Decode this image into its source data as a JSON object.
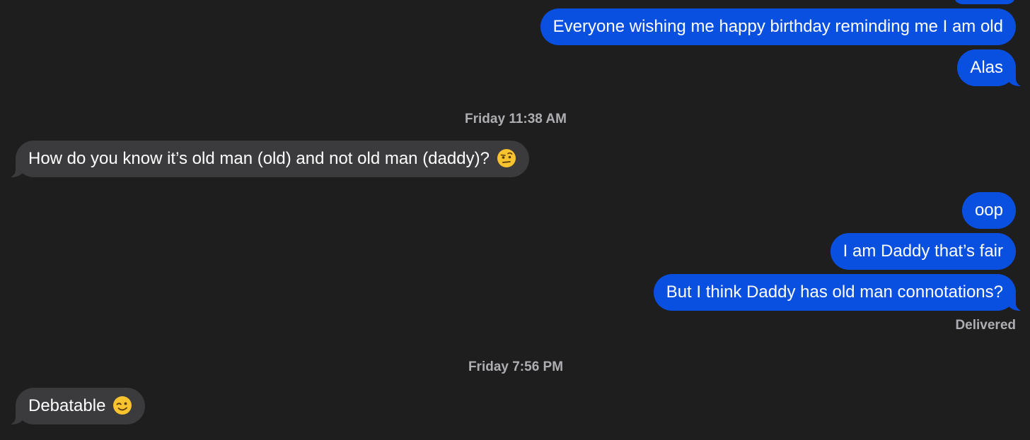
{
  "conversation": {
    "messages": [
      {
        "id": "m1",
        "sender": "me",
        "text": "Everyone wishing me happy birthday reminding me I am old"
      },
      {
        "id": "m2",
        "sender": "me",
        "text": "Alas"
      },
      {
        "id": "m3",
        "sender": "them",
        "text": "How do you know it’s old man (old) and not old man (daddy)?",
        "emoji": "raised-eyebrow-face"
      },
      {
        "id": "m4",
        "sender": "me",
        "text": "oop"
      },
      {
        "id": "m5",
        "sender": "me",
        "text": "I am Daddy that’s fair"
      },
      {
        "id": "m6",
        "sender": "me",
        "text": "But I think Daddy has old man connotations?"
      },
      {
        "id": "m7",
        "sender": "them",
        "text": "Debatable",
        "emoji": "winking-face"
      }
    ],
    "timestamps": [
      {
        "text": "Friday 11:38 AM"
      },
      {
        "text": "Friday 7:56 PM"
      }
    ],
    "status": "Delivered"
  },
  "colors": {
    "background": "#1e1e1e",
    "sent_bubble": "#0a50e0",
    "received_bubble": "#3b3b3d",
    "meta_text": "#aeaeb2"
  }
}
